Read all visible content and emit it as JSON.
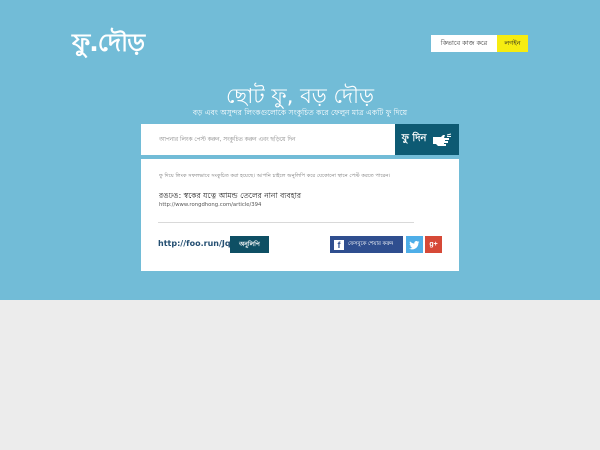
{
  "brand": {
    "logo_text": "ফু.দৌড়"
  },
  "nav": {
    "how_it_works": "কিভাবে কাজ করে",
    "login": "লগইন"
  },
  "hero": {
    "headline": "ছোট ফু, বড় দৌড়",
    "subheadline": "বড় এবং অসুন্দর লিংকগুলোকে সংকুচিত করে ফেলুন মাত্র একটি ফু দিয়ে"
  },
  "search": {
    "placeholder": "আপনার লিংক পেস্ট করুন, সংকুচিত করুন এবং ছড়িয়ে দিন",
    "button_label": "ফু দিন",
    "button_icon": "hand-blow-icon"
  },
  "result": {
    "success_message": "ফু দিয়ে লিংক সফলভাবে সংকুচিত করা হয়েছে। আপনি চাইলে অনুলিপি করে যেকোনো স্থানে পেস্ট করতে পারেন।",
    "link_title": "রঙঢঙ: স্বকের যত্নে আমন্ড তেলের নানা ব্যবহার",
    "original_url": "http://www.rongdhong.com/article/394",
    "short_url": "http://foo.run/Jqb",
    "copy_label": "অনুলিপি",
    "facebook_share_label": "ফেসবুকে শেয়ার করুন",
    "facebook_icon": "facebook-icon",
    "twitter_icon": "twitter-icon",
    "googleplus_icon": "google-plus-icon"
  },
  "colors": {
    "hero_bg": "#72bcd7",
    "page_bg": "#ececec",
    "primary_button": "#0d5a73",
    "login_bg": "#f6ec11",
    "facebook": "#2f4e8f",
    "twitter": "#4eaee8",
    "googleplus": "#d64937",
    "short_url_text": "#244f72"
  }
}
